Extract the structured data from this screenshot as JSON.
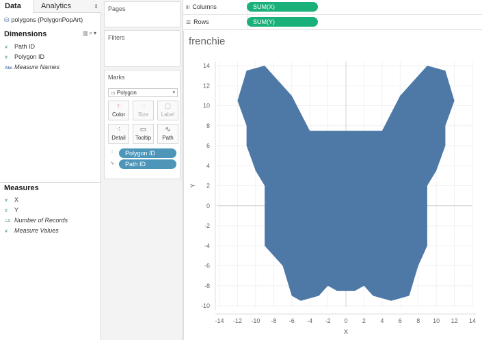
{
  "data_pane": {
    "tabs": [
      "Data",
      "Analytics"
    ],
    "datasource": "polygons (PolygonPopArt)",
    "dimensions_label": "Dimensions",
    "dimensions": [
      {
        "label": "Path ID",
        "icon": "#",
        "italic": false
      },
      {
        "label": "Polygon ID",
        "icon": "#",
        "italic": false
      },
      {
        "label": "Measure Names",
        "icon": "Abc",
        "italic": true
      }
    ],
    "measures_label": "Measures",
    "measures": [
      {
        "label": "X",
        "icon": "#",
        "italic": false
      },
      {
        "label": "Y",
        "icon": "#",
        "italic": false
      },
      {
        "label": "Number of Records",
        "icon": "=#",
        "italic": true
      },
      {
        "label": "Measure Values",
        "icon": "#",
        "italic": true
      }
    ]
  },
  "shelves": {
    "pages_label": "Pages",
    "filters_label": "Filters",
    "marks_label": "Marks",
    "mark_type": "Polygon",
    "mark_buttons": [
      {
        "label": "Color",
        "icon": "color-dots-icon",
        "enabled": true
      },
      {
        "label": "Size",
        "icon": "size-icon",
        "enabled": false
      },
      {
        "label": "Label",
        "icon": "label-icon",
        "enabled": false
      },
      {
        "label": "Detail",
        "icon": "detail-icon",
        "enabled": true
      },
      {
        "label": "Tooltip",
        "icon": "tooltip-icon",
        "enabled": true
      },
      {
        "label": "Path",
        "icon": "path-icon",
        "enabled": true
      }
    ],
    "mark_pills": [
      {
        "label": "Polygon ID",
        "icon": "detail-icon"
      },
      {
        "label": "Path ID",
        "icon": "path-icon"
      }
    ],
    "columns_label": "Columns",
    "columns_pill": "SUM(X)",
    "rows_label": "Rows",
    "rows_pill": "SUM(Y)"
  },
  "colors": {
    "polygon_fill": "#4e79a7",
    "measure_pill": "#1ab07a",
    "dimension_pill": "#4d96ba"
  },
  "chart_data": {
    "type": "polygon",
    "title": "frenchie",
    "xlabel": "X",
    "ylabel": "Y",
    "xlim": [
      -14,
      14
    ],
    "ylim": [
      -10,
      14
    ],
    "xticks": [
      -14,
      -12,
      -10,
      -8,
      -6,
      -4,
      -2,
      0,
      2,
      4,
      6,
      8,
      10,
      12,
      14
    ],
    "yticks": [
      -10,
      -8,
      -6,
      -4,
      -2,
      0,
      2,
      4,
      6,
      8,
      10,
      12,
      14
    ],
    "grid": true,
    "polygon": [
      [
        -9,
        14
      ],
      [
        -6,
        11
      ],
      [
        -4,
        7.5
      ],
      [
        4,
        7.5
      ],
      [
        6,
        11
      ],
      [
        9,
        14
      ],
      [
        11,
        13.5
      ],
      [
        12,
        10.5
      ],
      [
        11,
        8
      ],
      [
        11,
        6
      ],
      [
        10,
        3.5
      ],
      [
        9,
        2
      ],
      [
        9,
        -4
      ],
      [
        8,
        -6
      ],
      [
        7,
        -9
      ],
      [
        5,
        -9.5
      ],
      [
        3,
        -9
      ],
      [
        2,
        -8
      ],
      [
        1,
        -8.5
      ],
      [
        -1,
        -8.5
      ],
      [
        -2,
        -8
      ],
      [
        -3,
        -9
      ],
      [
        -5,
        -9.5
      ],
      [
        -6,
        -9
      ],
      [
        -7,
        -6
      ],
      [
        -9,
        -4
      ],
      [
        -9,
        2
      ],
      [
        -10,
        3.5
      ],
      [
        -11,
        6
      ],
      [
        -11,
        8
      ],
      [
        -12,
        10.5
      ],
      [
        -11,
        13.5
      ]
    ]
  }
}
